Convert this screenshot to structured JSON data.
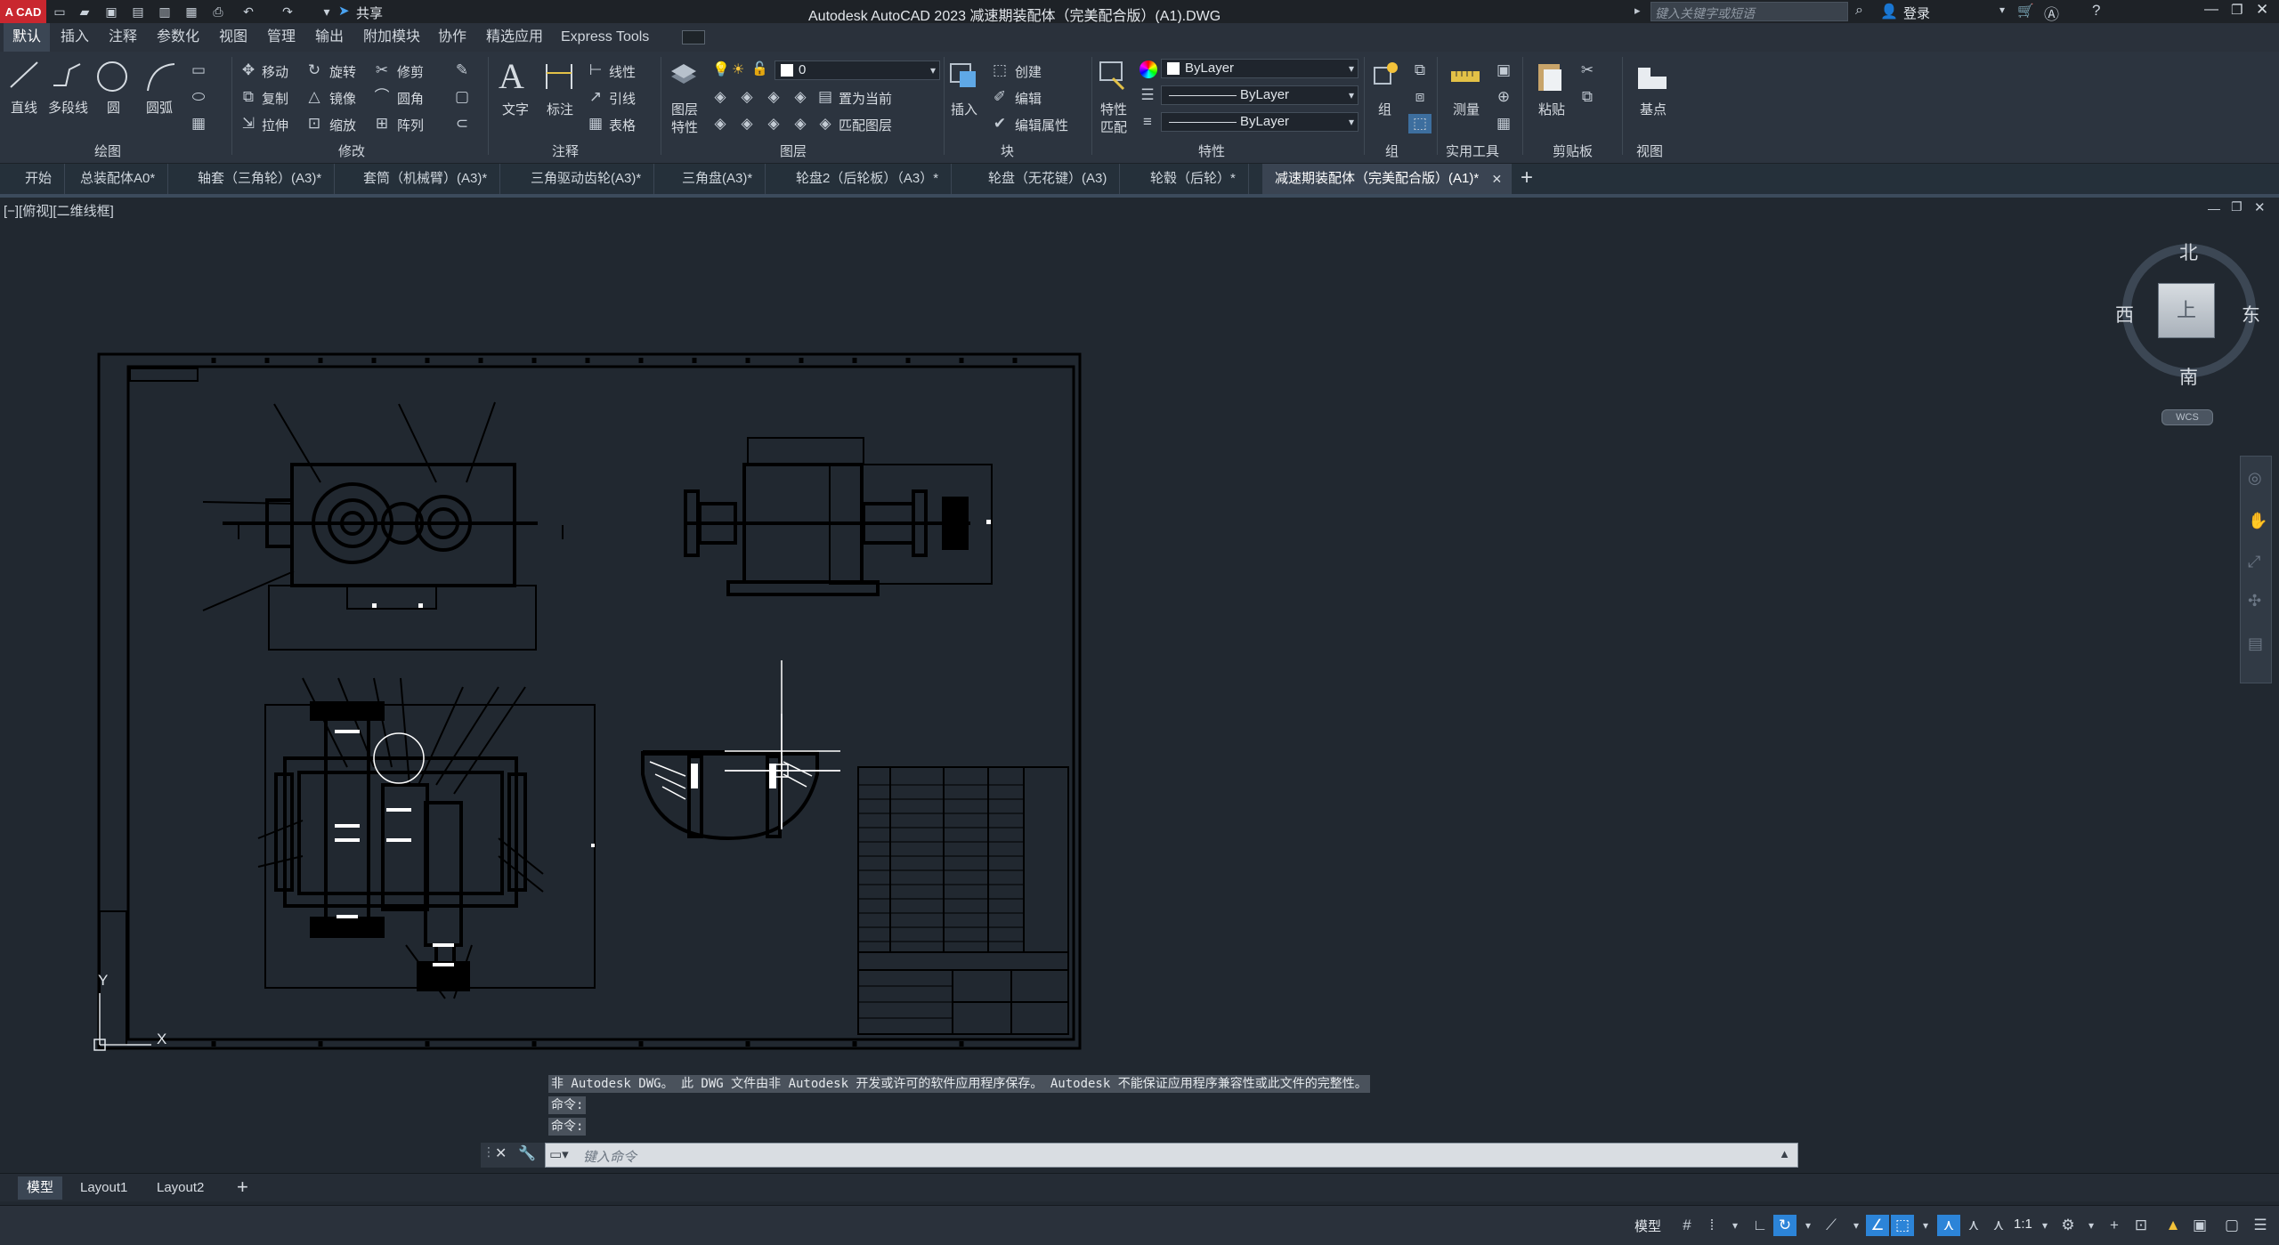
{
  "titlebar": {
    "logo": "A CAD",
    "share": "共享",
    "title": "Autodesk AutoCAD 2023    减速期装配体（完美配合版）(A1).DWG",
    "search_placeholder": "键入关键字或短语",
    "login": "登录"
  },
  "ribbon_tabs": [
    "默认",
    "插入",
    "注释",
    "参数化",
    "视图",
    "管理",
    "输出",
    "附加模块",
    "协作",
    "精选应用",
    "Express Tools"
  ],
  "ribbon": {
    "draw": {
      "line": "直线",
      "polyline": "多段线",
      "circle": "圆",
      "arc": "圆弧",
      "group": "绘图"
    },
    "modify": {
      "move": "移动",
      "rotate": "旋转",
      "trim": "修剪",
      "copy": "复制",
      "mirror": "镜像",
      "fillet": "圆角",
      "stretch": "拉伸",
      "scale": "缩放",
      "array": "阵列",
      "group": "修改"
    },
    "annotation": {
      "text": "文字",
      "dimension": "标注",
      "linear": "线性",
      "leader": "引线",
      "table": "表格",
      "group": "注释"
    },
    "layers": {
      "properties": "图层",
      "properties2": "特性",
      "layer_value": "0",
      "make_current": "置为当前",
      "match_layer": "匹配图层",
      "group": "图层"
    },
    "block": {
      "insert": "插入",
      "create": "创建",
      "edit": "编辑",
      "edit_attr": "编辑属性",
      "group": "块"
    },
    "properties": {
      "match": "特性",
      "match2": "匹配",
      "color": "ByLayer",
      "linetype": "ByLayer",
      "lineweight": "ByLayer",
      "group": "特性"
    },
    "groups": {
      "group": "组",
      "group_label": "组"
    },
    "utilities": {
      "measure": "测量",
      "group": "实用工具"
    },
    "clipboard": {
      "paste": "粘贴",
      "group": "剪贴板"
    },
    "view": {
      "basepoint": "基点",
      "group": "视图"
    }
  },
  "doc_tabs": [
    "开始",
    "总装配体A0*",
    "轴套（三角轮）(A3)*",
    "套筒（机械臂）(A3)*",
    "三角驱动齿轮(A3)*",
    "三角盘(A3)*",
    "轮盘2（后轮板）（A3）*",
    "轮盘（无花键）(A3)",
    "轮毂（后轮）*",
    "减速期装配体（完美配合版）(A1)*"
  ],
  "viewport": {
    "label": "[−][俯视][二维线框]",
    "viewcube": {
      "north": "北",
      "south": "南",
      "east": "东",
      "west": "西",
      "top": "上",
      "wcs": "WCS"
    },
    "ucs": {
      "x": "X",
      "y": "Y"
    }
  },
  "command": {
    "history": [
      "非 Autodesk DWG。 此 DWG 文件由非 Autodesk 开发或许可的软件应用程序保存。 Autodesk 不能保证应用程序兼容性或此文件的完整性。",
      "命令:",
      "命令:"
    ],
    "placeholder": "键入命令"
  },
  "layout_tabs": [
    "模型",
    "Layout1",
    "Layout2"
  ],
  "status": {
    "model": "模型",
    "scale": "1:1"
  },
  "colors": {
    "accent": "#2c84d8",
    "bg": "#212830"
  }
}
